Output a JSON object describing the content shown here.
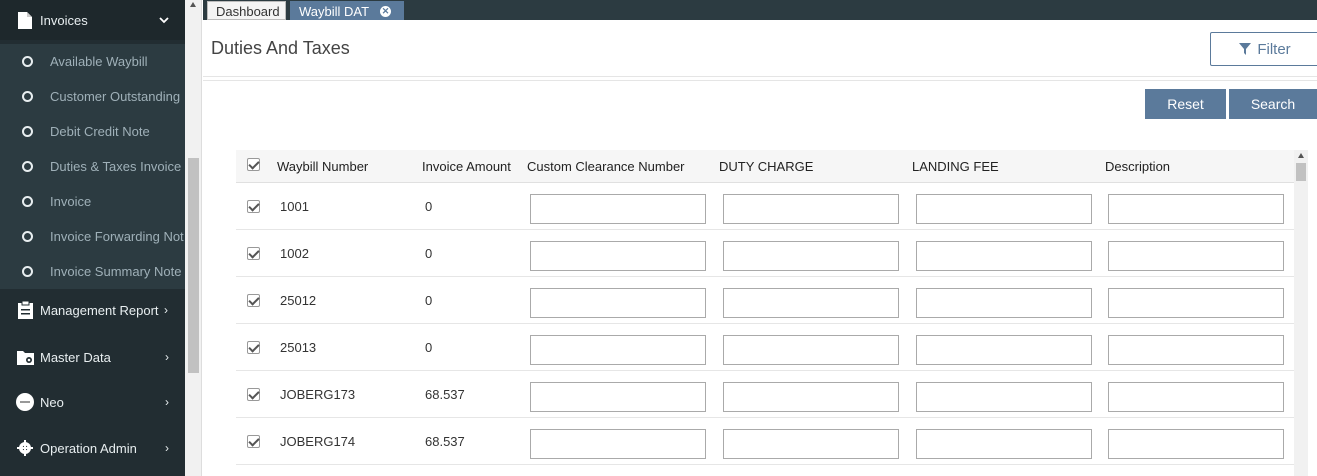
{
  "sidebar": {
    "header": {
      "label": "Invoices",
      "icon": "file-icon",
      "chevron": "⌄"
    },
    "sub_items": [
      {
        "label": "Available Waybill"
      },
      {
        "label": "Customer Outstanding"
      },
      {
        "label": "Debit Credit Note"
      },
      {
        "label": "Duties & Taxes Invoice"
      },
      {
        "label": "Invoice"
      },
      {
        "label": "Invoice Forwarding Not"
      },
      {
        "label": "Invoice Summary Note"
      }
    ],
    "sections": [
      {
        "label": "Management Report",
        "icon": "clipboard-icon",
        "chevron": "›"
      },
      {
        "label": "Master Data",
        "icon": "folder-gear-icon",
        "chevron": "›"
      },
      {
        "label": "Neo",
        "icon": "neo-logo-icon",
        "chevron": "›"
      },
      {
        "label": "Operation Admin",
        "icon": "gear-icon",
        "chevron": "›"
      }
    ]
  },
  "tabs": [
    {
      "label": "Dashboard"
    },
    {
      "label": "Waybill DAT",
      "close": "✕"
    }
  ],
  "page": {
    "title": "Duties And Taxes",
    "filter_label": "Filter",
    "reset_label": "Reset",
    "search_label": "Search"
  },
  "table": {
    "columns": [
      "Waybill Number",
      "Invoice Amount",
      "Custom Clearance Number",
      "DUTY CHARGE",
      "LANDING FEE",
      "Description"
    ],
    "rows": [
      {
        "waybill": "1001",
        "amount": "0"
      },
      {
        "waybill": "1002",
        "amount": "0"
      },
      {
        "waybill": "25012",
        "amount": "0"
      },
      {
        "waybill": "25013",
        "amount": "0"
      },
      {
        "waybill": "JOBERG173",
        "amount": "68.537"
      },
      {
        "waybill": "JOBERG174",
        "amount": "68.537"
      }
    ]
  },
  "colors": {
    "sidebar_bg": "#222d32",
    "sub_bg": "#2c3b41",
    "accent": "#5b7a9b"
  }
}
